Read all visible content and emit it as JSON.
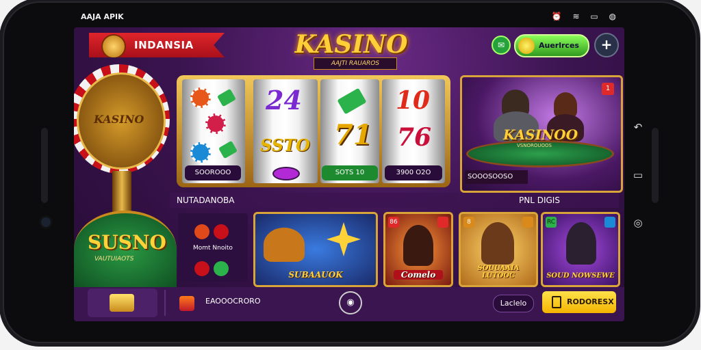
{
  "status_bar": {
    "carrier": "AAJA APIK",
    "icons": "⏰ ≋ ▭ ◍"
  },
  "header": {
    "region_banner": "INDANSIA",
    "logo_title": "KASINO",
    "logo_subtitle": "AAJTI RAUAROS",
    "balance_label": "Auerlrces",
    "add_icon": "+"
  },
  "roulette": {
    "wheel_label": "KASINO"
  },
  "promo_table": {
    "title": "SUSNO",
    "subtitle": "VAUTUIAOTS"
  },
  "slot_machine": {
    "reel1_button": "SOOROOO",
    "reel2_symbol": "24",
    "reel2_mid": "SSTO",
    "reel3_symbol": "71",
    "reel3_button": "SOTS 10",
    "reel4_symbol": "10",
    "reel4_mid": "76",
    "reel4_button": "3900 O2O"
  },
  "live_casino": {
    "title": "KASINOO",
    "subtitle": "VSNOROUOOS",
    "label": "SOOOSOOSO",
    "badge": "1"
  },
  "sections": {
    "left_label": "NUTADANOBA",
    "right_label": "PNL DIGIS"
  },
  "games": {
    "mini_label": "Momt Nnoito",
    "card1": "SUBAAUOK",
    "card2_tag": "86",
    "card2": "Comelo",
    "card3_tag": "8",
    "card3": "SOUUAAIA LUTOOC",
    "card4_tag": "RC",
    "card4": "SOUD NOWSEWE"
  },
  "bottom_nav": {
    "center_text": "EAOOOCRORO",
    "language": "Laclelo",
    "deposit": "RODORESX"
  }
}
